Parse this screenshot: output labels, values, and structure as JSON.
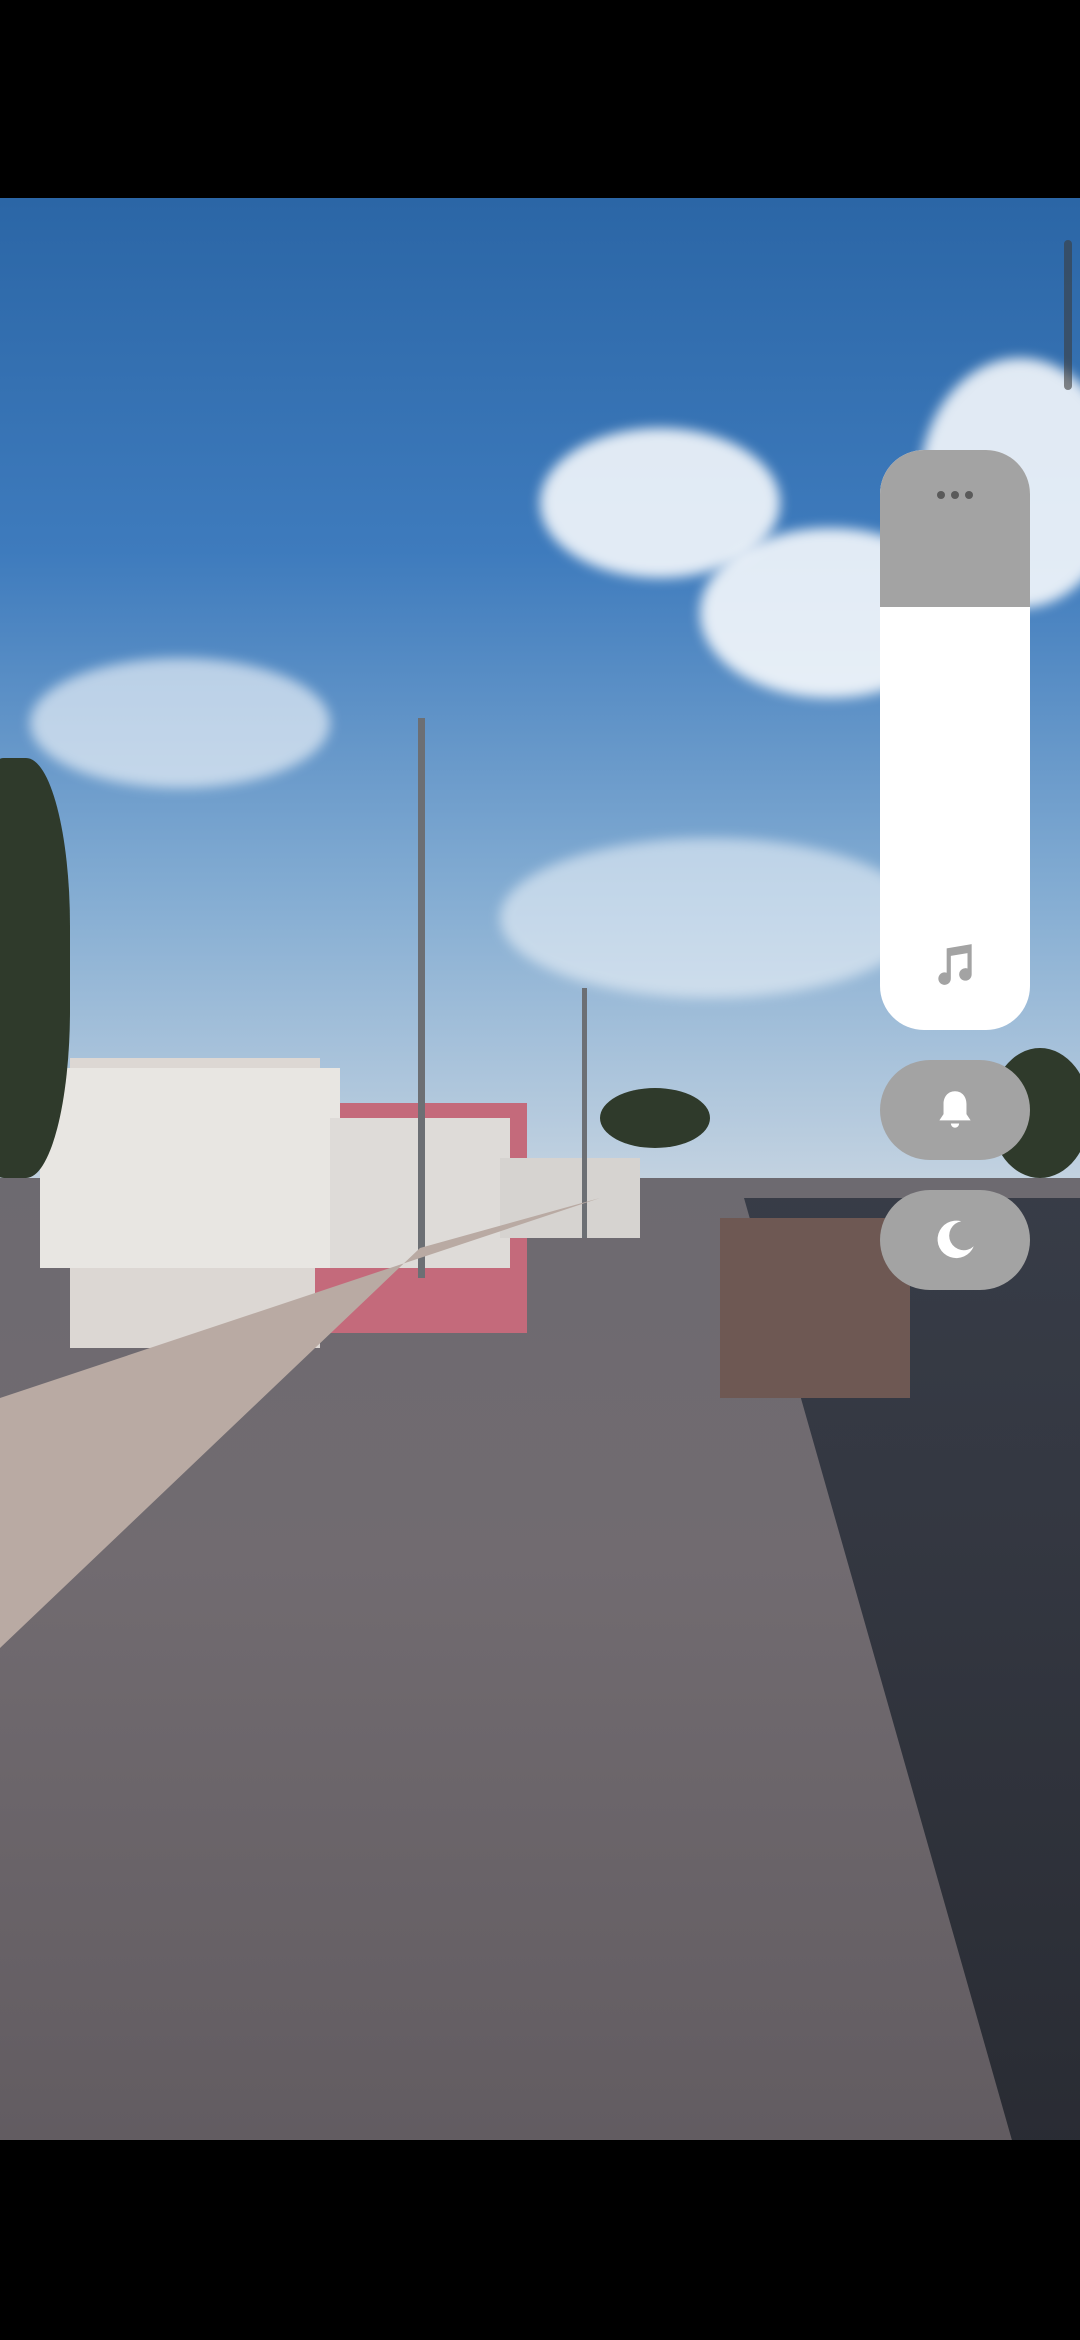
{
  "screen": {
    "description_label": "",
    "volume": {
      "level_percent": 73,
      "more_icon": "more-horizontal-icon",
      "stream_icon": "music-note-icon"
    },
    "ringer_button": {
      "icon": "bell-icon"
    },
    "dnd_button": {
      "icon": "moon-icon"
    },
    "colors": {
      "panel_fill": "#ffffff",
      "panel_track": "#a3a3a3",
      "icon_dark": "#5a5a5a",
      "icon_light": "#ffffff"
    }
  }
}
